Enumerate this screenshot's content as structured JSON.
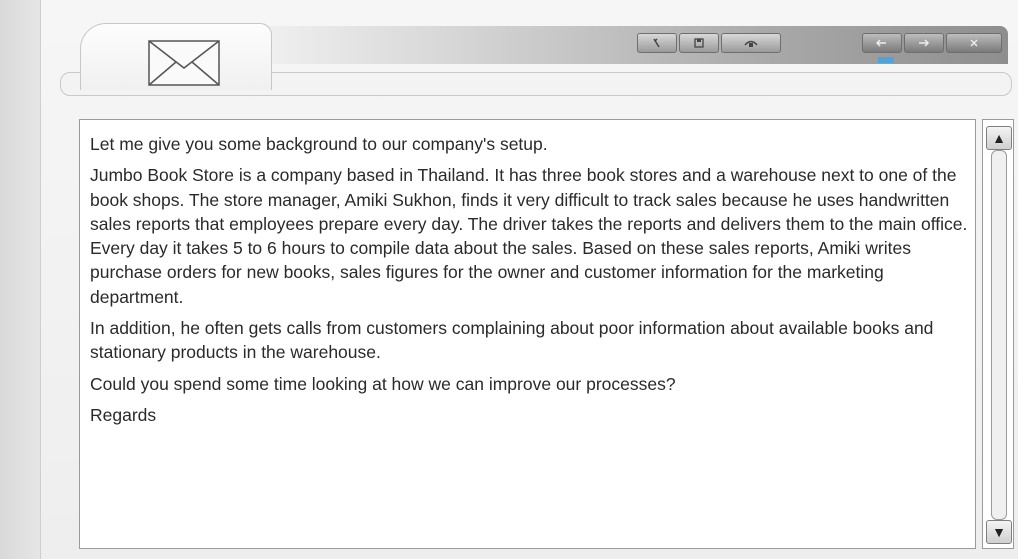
{
  "window": {
    "controls_center": [
      {
        "icon": "wrench-icon"
      },
      {
        "icon": "save-icon"
      },
      {
        "icon": "attach-icon"
      }
    ],
    "controls_right": [
      {
        "icon": "reply-icon"
      },
      {
        "icon": "forward-icon"
      },
      {
        "icon": "close-icon"
      }
    ]
  },
  "message": {
    "paragraphs": [
      "Let me give you some background to our company's setup.",
      "Jumbo Book Store is a company based in Thailand. It has three book stores and a warehouse next to one of the book shops. The store manager, Amiki Sukhon, finds it very difficult to track sales because he uses handwritten sales reports that employees prepare every day. The driver takes the reports and delivers them to the main office. Every day it takes 5 to 6 hours to compile data about the sales. Based on these sales reports, Amiki writes purchase orders for new books, sales figures for the owner and customer information for the marketing department.",
      "In addition, he often gets calls from customers complaining about poor information about available books and stationary products in the warehouse.",
      "Could you spend some time looking at how we can improve our processes?",
      "Regards"
    ]
  },
  "scrollbar": {
    "up_glyph": "▲",
    "down_glyph": "▼"
  }
}
